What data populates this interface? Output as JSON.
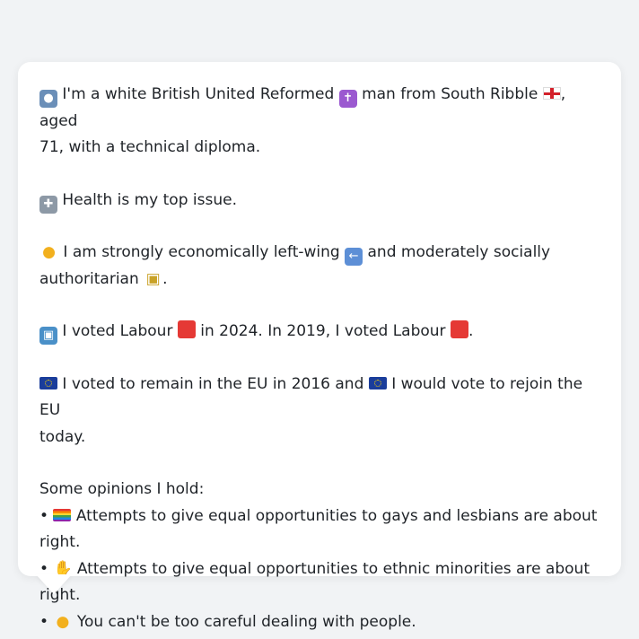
{
  "profile": {
    "intro_icon": "person-silhouette-icon",
    "intro_a": "I'm a white British United Reformed",
    "religion_icon": "latin-cross-icon",
    "intro_b": "man from South Ribble",
    "region_icon": "england-flag-icon",
    "intro_c": ", aged",
    "intro_d": "71, with a technical diploma.",
    "issue_icon": "hospital-icon",
    "issue_text": "Health is my top issue.",
    "politics_icon": "thinking-face-icon",
    "politics_a": "I am strongly economically left-wing",
    "left_icon": "left-arrow-icon",
    "politics_b": "and moderately socially",
    "politics_c": "authoritarian",
    "lock_icon": "lock-icon",
    "politics_end": ".",
    "vote_icon": "ballot-box-icon",
    "vote_a": "I voted Labour",
    "vote_b": "in 2024. In 2019, I voted Labour",
    "vote_end": ".",
    "labour_color": "#e53935",
    "eu_icon": "eu-flag-icon",
    "eu_a": "I voted to remain in the EU in 2016 and",
    "eu_b": "I would vote to rejoin the EU",
    "eu_c": "today.",
    "opinions_heading": "Some opinions I hold:",
    "bullet": "•",
    "op1_icon": "rainbow-flag-icon",
    "op1_a": "Attempts to give equal opportunities to gays and lesbians are about",
    "op1_b": "right.",
    "op2_icon": "handshake-icon",
    "op2": "Attempts to give equal opportunities to ethnic minorities are about right.",
    "op3_icon": "raised-eyebrow-face-icon",
    "op3": "You can't be too careful dealing with people."
  }
}
